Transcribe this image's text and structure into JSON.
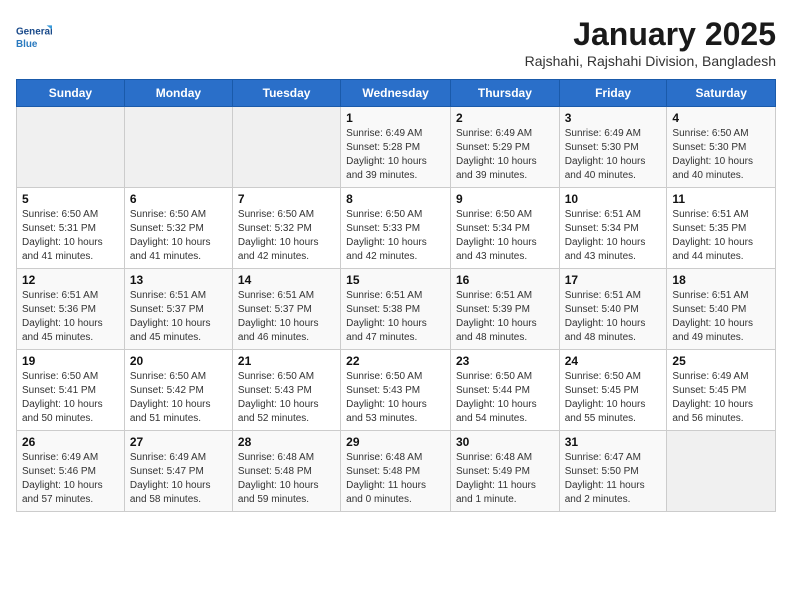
{
  "header": {
    "logo_line1": "General",
    "logo_line2": "Blue",
    "title": "January 2025",
    "subtitle": "Rajshahi, Rajshahi Division, Bangladesh"
  },
  "weekdays": [
    "Sunday",
    "Monday",
    "Tuesday",
    "Wednesday",
    "Thursday",
    "Friday",
    "Saturday"
  ],
  "weeks": [
    [
      {
        "day": "",
        "info": ""
      },
      {
        "day": "",
        "info": ""
      },
      {
        "day": "",
        "info": ""
      },
      {
        "day": "1",
        "info": "Sunrise: 6:49 AM\nSunset: 5:28 PM\nDaylight: 10 hours\nand 39 minutes."
      },
      {
        "day": "2",
        "info": "Sunrise: 6:49 AM\nSunset: 5:29 PM\nDaylight: 10 hours\nand 39 minutes."
      },
      {
        "day": "3",
        "info": "Sunrise: 6:49 AM\nSunset: 5:30 PM\nDaylight: 10 hours\nand 40 minutes."
      },
      {
        "day": "4",
        "info": "Sunrise: 6:50 AM\nSunset: 5:30 PM\nDaylight: 10 hours\nand 40 minutes."
      }
    ],
    [
      {
        "day": "5",
        "info": "Sunrise: 6:50 AM\nSunset: 5:31 PM\nDaylight: 10 hours\nand 41 minutes."
      },
      {
        "day": "6",
        "info": "Sunrise: 6:50 AM\nSunset: 5:32 PM\nDaylight: 10 hours\nand 41 minutes."
      },
      {
        "day": "7",
        "info": "Sunrise: 6:50 AM\nSunset: 5:32 PM\nDaylight: 10 hours\nand 42 minutes."
      },
      {
        "day": "8",
        "info": "Sunrise: 6:50 AM\nSunset: 5:33 PM\nDaylight: 10 hours\nand 42 minutes."
      },
      {
        "day": "9",
        "info": "Sunrise: 6:50 AM\nSunset: 5:34 PM\nDaylight: 10 hours\nand 43 minutes."
      },
      {
        "day": "10",
        "info": "Sunrise: 6:51 AM\nSunset: 5:34 PM\nDaylight: 10 hours\nand 43 minutes."
      },
      {
        "day": "11",
        "info": "Sunrise: 6:51 AM\nSunset: 5:35 PM\nDaylight: 10 hours\nand 44 minutes."
      }
    ],
    [
      {
        "day": "12",
        "info": "Sunrise: 6:51 AM\nSunset: 5:36 PM\nDaylight: 10 hours\nand 45 minutes."
      },
      {
        "day": "13",
        "info": "Sunrise: 6:51 AM\nSunset: 5:37 PM\nDaylight: 10 hours\nand 45 minutes."
      },
      {
        "day": "14",
        "info": "Sunrise: 6:51 AM\nSunset: 5:37 PM\nDaylight: 10 hours\nand 46 minutes."
      },
      {
        "day": "15",
        "info": "Sunrise: 6:51 AM\nSunset: 5:38 PM\nDaylight: 10 hours\nand 47 minutes."
      },
      {
        "day": "16",
        "info": "Sunrise: 6:51 AM\nSunset: 5:39 PM\nDaylight: 10 hours\nand 48 minutes."
      },
      {
        "day": "17",
        "info": "Sunrise: 6:51 AM\nSunset: 5:40 PM\nDaylight: 10 hours\nand 48 minutes."
      },
      {
        "day": "18",
        "info": "Sunrise: 6:51 AM\nSunset: 5:40 PM\nDaylight: 10 hours\nand 49 minutes."
      }
    ],
    [
      {
        "day": "19",
        "info": "Sunrise: 6:50 AM\nSunset: 5:41 PM\nDaylight: 10 hours\nand 50 minutes."
      },
      {
        "day": "20",
        "info": "Sunrise: 6:50 AM\nSunset: 5:42 PM\nDaylight: 10 hours\nand 51 minutes."
      },
      {
        "day": "21",
        "info": "Sunrise: 6:50 AM\nSunset: 5:43 PM\nDaylight: 10 hours\nand 52 minutes."
      },
      {
        "day": "22",
        "info": "Sunrise: 6:50 AM\nSunset: 5:43 PM\nDaylight: 10 hours\nand 53 minutes."
      },
      {
        "day": "23",
        "info": "Sunrise: 6:50 AM\nSunset: 5:44 PM\nDaylight: 10 hours\nand 54 minutes."
      },
      {
        "day": "24",
        "info": "Sunrise: 6:50 AM\nSunset: 5:45 PM\nDaylight: 10 hours\nand 55 minutes."
      },
      {
        "day": "25",
        "info": "Sunrise: 6:49 AM\nSunset: 5:45 PM\nDaylight: 10 hours\nand 56 minutes."
      }
    ],
    [
      {
        "day": "26",
        "info": "Sunrise: 6:49 AM\nSunset: 5:46 PM\nDaylight: 10 hours\nand 57 minutes."
      },
      {
        "day": "27",
        "info": "Sunrise: 6:49 AM\nSunset: 5:47 PM\nDaylight: 10 hours\nand 58 minutes."
      },
      {
        "day": "28",
        "info": "Sunrise: 6:48 AM\nSunset: 5:48 PM\nDaylight: 10 hours\nand 59 minutes."
      },
      {
        "day": "29",
        "info": "Sunrise: 6:48 AM\nSunset: 5:48 PM\nDaylight: 11 hours\nand 0 minutes."
      },
      {
        "day": "30",
        "info": "Sunrise: 6:48 AM\nSunset: 5:49 PM\nDaylight: 11 hours\nand 1 minute."
      },
      {
        "day": "31",
        "info": "Sunrise: 6:47 AM\nSunset: 5:50 PM\nDaylight: 11 hours\nand 2 minutes."
      },
      {
        "day": "",
        "info": ""
      }
    ]
  ]
}
